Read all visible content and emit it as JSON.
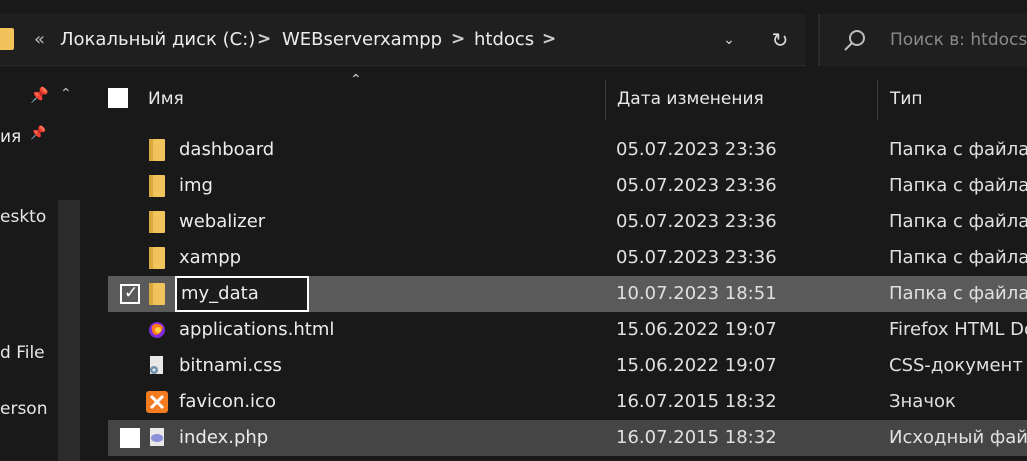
{
  "address_bar": {
    "overflow_chevron": "«",
    "crumbs": [
      "Локальный диск (C:)",
      "WEBserverxampp",
      "htdocs"
    ],
    "separator": ">",
    "dropdown_icon": "chevron-down-icon",
    "refresh_icon": "refresh-icon"
  },
  "search": {
    "placeholder": "Поиск в: htdocs",
    "icon": "search-icon"
  },
  "nav_pane": {
    "items": [
      "ия",
      "eskto",
      "d File",
      "erson"
    ]
  },
  "columns": {
    "name": "Имя",
    "date": "Дата изменения",
    "type": "Тип"
  },
  "files": [
    {
      "name": "dashboard",
      "date": "05.07.2023 23:36",
      "type": "Папка с файлами",
      "icon": "folder-icon"
    },
    {
      "name": "img",
      "date": "05.07.2023 23:36",
      "type": "Папка с файлами",
      "icon": "folder-icon"
    },
    {
      "name": "webalizer",
      "date": "05.07.2023 23:36",
      "type": "Папка с файлами",
      "icon": "folder-icon"
    },
    {
      "name": "xampp",
      "date": "05.07.2023 23:36",
      "type": "Папка с файлами",
      "icon": "folder-icon"
    },
    {
      "name": "my_data",
      "date": "10.07.2023 18:51",
      "type": "Папка с файлами",
      "icon": "folder-icon",
      "state": "renaming, checked"
    },
    {
      "name": "applications.html",
      "date": "15.06.2022 19:07",
      "type": "Firefox HTML Document",
      "icon": "firefox-icon"
    },
    {
      "name": "bitnami.css",
      "date": "15.06.2022 19:07",
      "type": "CSS-документ",
      "icon": "css-file-icon"
    },
    {
      "name": "favicon.ico",
      "date": "16.07.2015 18:32",
      "type": "Значок",
      "icon": "xampp-icon"
    },
    {
      "name": "index.php",
      "date": "16.07.2015 18:32",
      "type": "Исходный файл PHP",
      "icon": "php-file-icon"
    }
  ],
  "colors": {
    "background": "#191919",
    "selected_row": "#5a5a5a",
    "hover_row": "#454545",
    "folder": "#f2c35a",
    "text": "#ececec"
  }
}
